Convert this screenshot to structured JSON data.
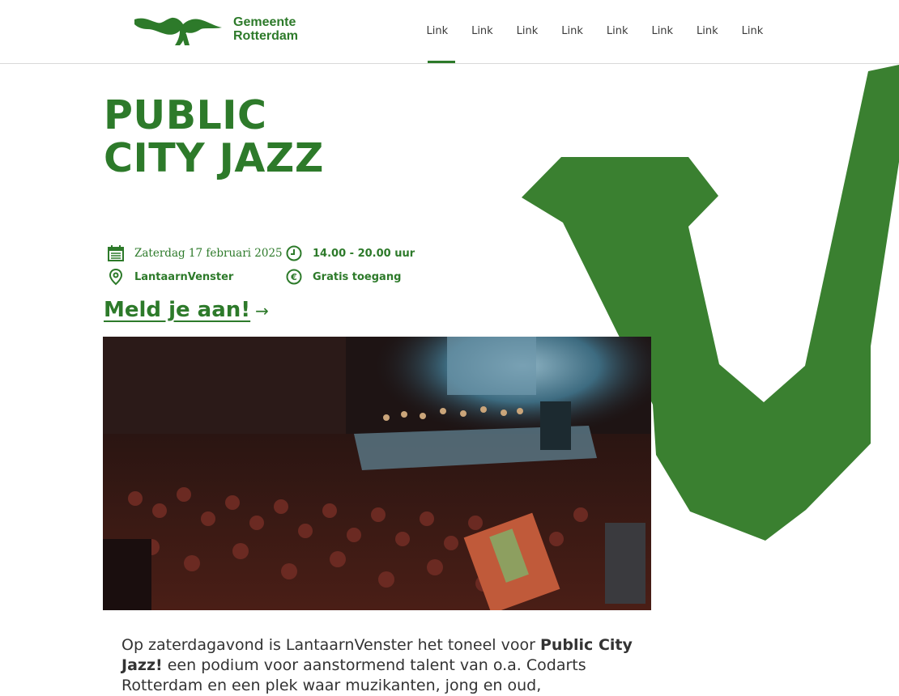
{
  "header": {
    "logo_line1": "Gemeente",
    "logo_line2": "Rotterdam",
    "nav": [
      "Link",
      "Link",
      "Link",
      "Link",
      "Link",
      "Link",
      "Link",
      "Link"
    ]
  },
  "hero": {
    "title_line1": "PUBLIC",
    "title_line2": "CITY JAZZ"
  },
  "details": {
    "date": "Zaterdag 17 februari 2025",
    "time": "14.00 - 20.00 uur",
    "location": "LantaarnVenster",
    "price": "Gratis toegang"
  },
  "cta": {
    "label": "Meld je aan!",
    "arrow": "→"
  },
  "body": {
    "intro_prefix": "Op zaterdagavond is LantaarnVenster het toneel voor ",
    "intro_bold": "Public City Jazz!",
    "intro_suffix": " een podium voor aanstormend talent van o.a. Codarts Rotterdam en een plek waar muzikanten, jong en oud,"
  },
  "colors": {
    "brand": "#2d7a2a",
    "text": "#333333"
  },
  "icons": [
    "calendar-icon",
    "clock-icon",
    "location-pin-icon",
    "euro-icon",
    "arrow-right-icon"
  ]
}
